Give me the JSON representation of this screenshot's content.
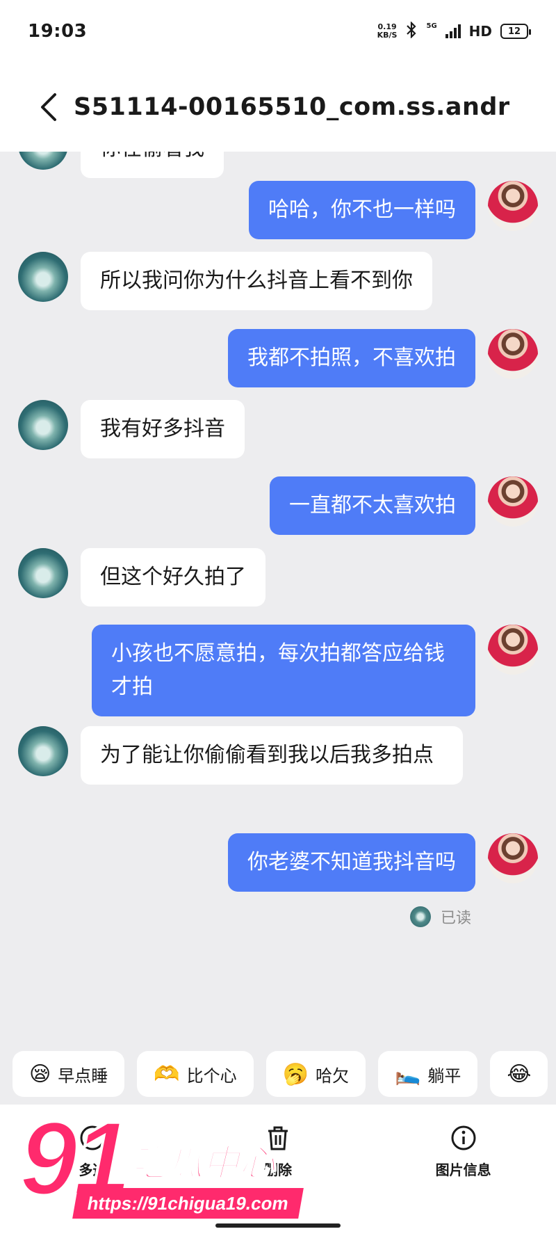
{
  "status_bar": {
    "time": "19:03",
    "net_speed_value": "0.19",
    "net_speed_unit": "KB/S",
    "network_label": "5G",
    "hd_label": "HD",
    "battery": "12"
  },
  "header": {
    "title": "S51114-00165510_com.ss.andr"
  },
  "messages": [
    {
      "from": "other",
      "text": "你在偷看我"
    },
    {
      "from": "self",
      "text": "哈哈，你不也一样吗"
    },
    {
      "from": "other",
      "text": "所以我问你为什么抖音上看不到你"
    },
    {
      "from": "self",
      "text": "我都不拍照，不喜欢拍"
    },
    {
      "from": "other",
      "text": "我有好多抖音"
    },
    {
      "from": "self",
      "text": "一直都不太喜欢拍"
    },
    {
      "from": "other",
      "text": "但这个好久拍了"
    },
    {
      "from": "self",
      "text": "小孩也不愿意拍，每次拍都答应给钱才拍"
    },
    {
      "from": "other",
      "text": "为了能让你偷偷看到我以后我多拍点"
    },
    {
      "from": "self",
      "text": "你老婆不知道我抖音吗"
    }
  ],
  "read_receipt": "已读",
  "quick_replies": [
    {
      "icon": "sleep-emoji-icon",
      "glyph": "😪",
      "label": "早点睡"
    },
    {
      "icon": "heart-emoji-icon",
      "glyph": "🫶",
      "label": "比个心"
    },
    {
      "icon": "yawn-emoji-icon",
      "glyph": "🥱",
      "label": "哈欠"
    },
    {
      "icon": "lie-flat-emoji-icon",
      "glyph": "🛌",
      "label": "躺平"
    },
    {
      "icon": "more-emoji-icon",
      "glyph": "😂",
      "label": ""
    }
  ],
  "bottom_actions": {
    "multi_select_label": "多选",
    "delete_label": "删除",
    "image_info_label": "图片信息"
  },
  "watermark": {
    "number": "91",
    "brand": "吃瓜中心",
    "url": "https://91chigua19.com"
  },
  "colors": {
    "self_bubble": "#4f7cf7",
    "other_bubble": "#ffffff",
    "chat_background": "#ededef",
    "watermark_pink": "#ff2a6d"
  }
}
